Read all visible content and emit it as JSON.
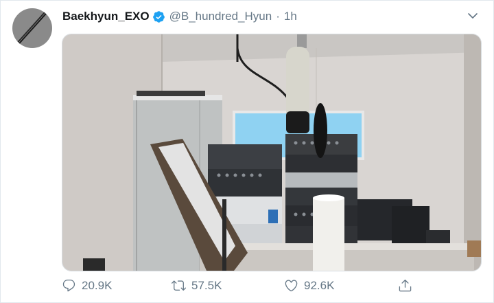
{
  "tweet": {
    "display_name": "Baekhyun_EXO",
    "handle": "@B_hundred_Hyun",
    "separator": "·",
    "timestamp": "1h",
    "verified": true,
    "media": {
      "icon": "photo-of-recording-studio"
    }
  },
  "actions": {
    "reply_count": "20.9K",
    "retweet_count": "57.5K",
    "like_count": "92.6K"
  },
  "colors": {
    "verified_blue": "#1da1f2",
    "muted_text": "#657786",
    "border": "#e1e8ed"
  }
}
